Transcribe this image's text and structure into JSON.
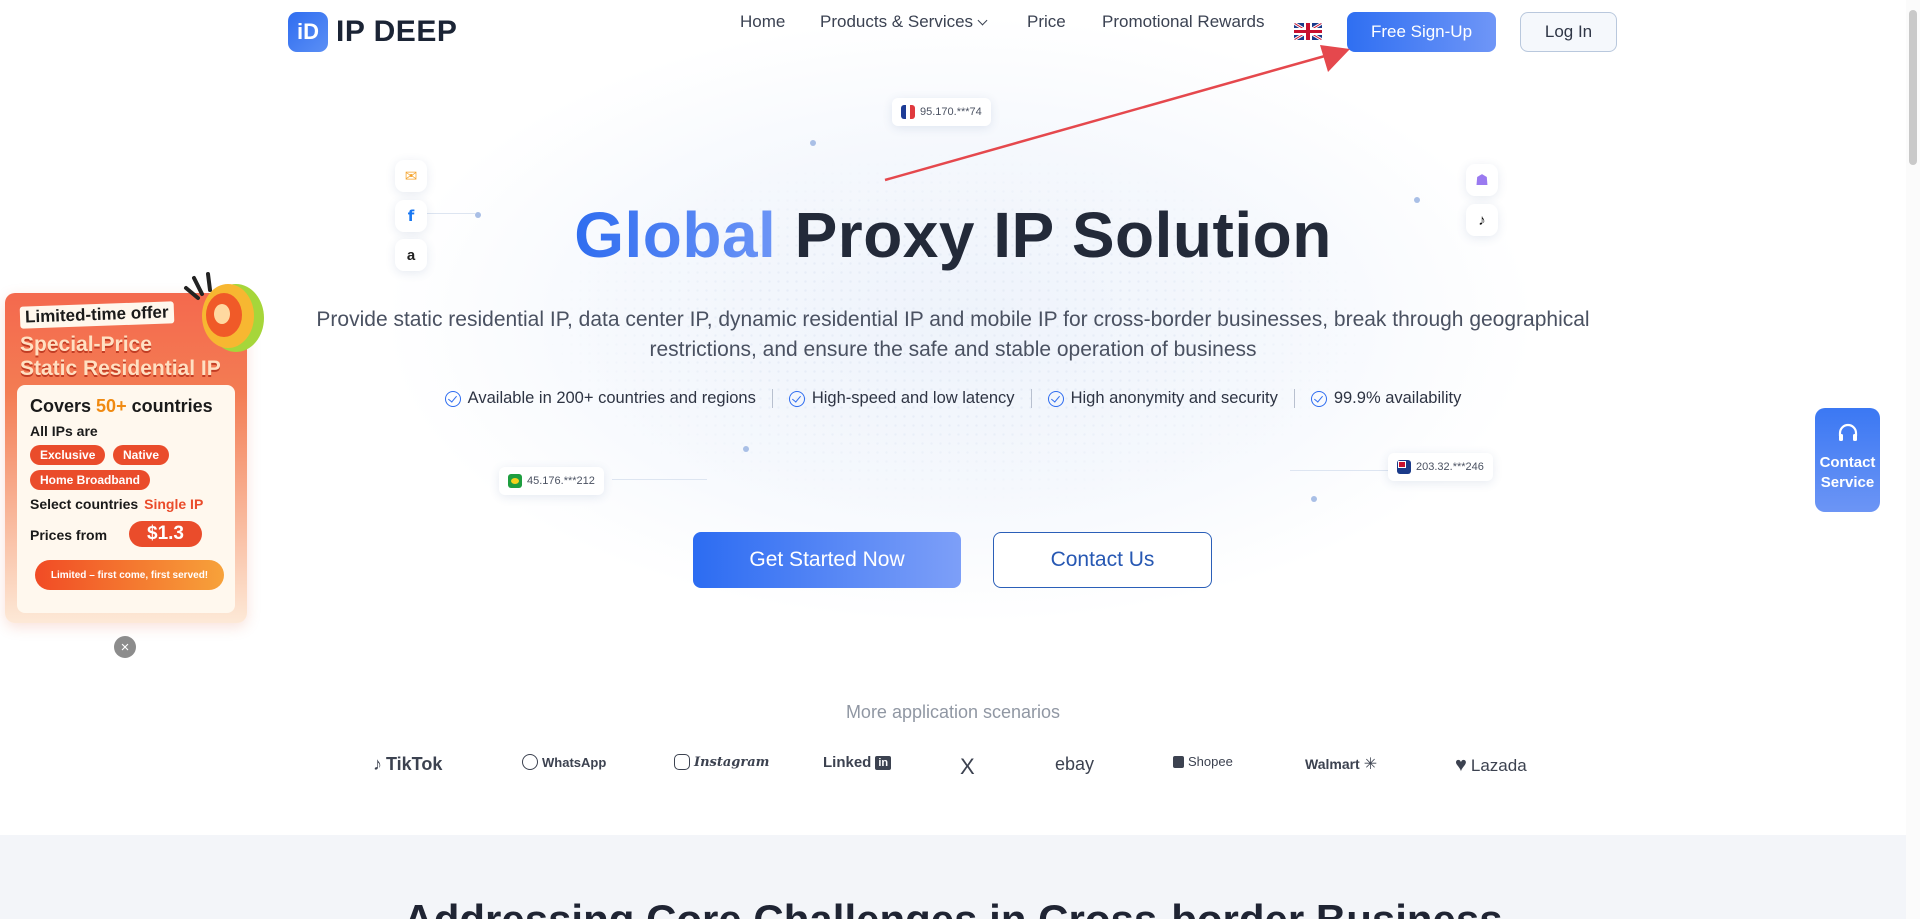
{
  "brand": {
    "logo_mark": "iD",
    "name": "IP DEEP"
  },
  "nav": {
    "items": [
      "Home",
      "Products & Services",
      "Price",
      "Promotional Rewards"
    ],
    "language_icon": "uk-flag-icon",
    "signup": "Free Sign-Up",
    "login": "Log In"
  },
  "hero": {
    "title_accent": "Global",
    "title_rest": "Proxy IP Solution",
    "subtitle": "Provide static residential IP, data center IP, dynamic residential IP and mobile IP for cross-border businesses, break through geographical restrictions, and ensure the safe and stable operation of business",
    "features": [
      "Available in 200+ countries and regions",
      "High-speed and low latency",
      "High anonymity and security",
      "99.9% availability"
    ],
    "cta_primary": "Get Started Now",
    "cta_secondary": "Contact Us"
  },
  "floating_ips": [
    "95.170.***74",
    "45.176.***212",
    "203.32.***246"
  ],
  "promo": {
    "tag": "Limited-time offer",
    "headline_1": "Special-Price",
    "headline_2": "Static Residential IP",
    "covers_prefix": "Covers ",
    "covers_highlight": "50+",
    "covers_suffix": " countries",
    "all_ips": "All IPs are",
    "badges": [
      "Exclusive",
      "Native",
      "Home Broadband"
    ],
    "select_prefix": "Select countries",
    "select_highlight": "Single IP",
    "prices_from": "Prices from",
    "price": "$1.3",
    "cta": "Limited – first come, first served!",
    "close": "×"
  },
  "contact_service": {
    "line1": "Contact",
    "line2": "Service"
  },
  "scenarios": {
    "title": "More application scenarios",
    "brands": [
      "TikTok",
      "WhatsApp",
      "Instagram",
      "Linked",
      "X",
      "ebay",
      "Shopee",
      "Walmart",
      "Lazada"
    ]
  },
  "next_section_title": "Addressing Core Challenges in Cross-border Business",
  "colors": {
    "accent": "#2f6df0",
    "promo": "#f4694e"
  }
}
